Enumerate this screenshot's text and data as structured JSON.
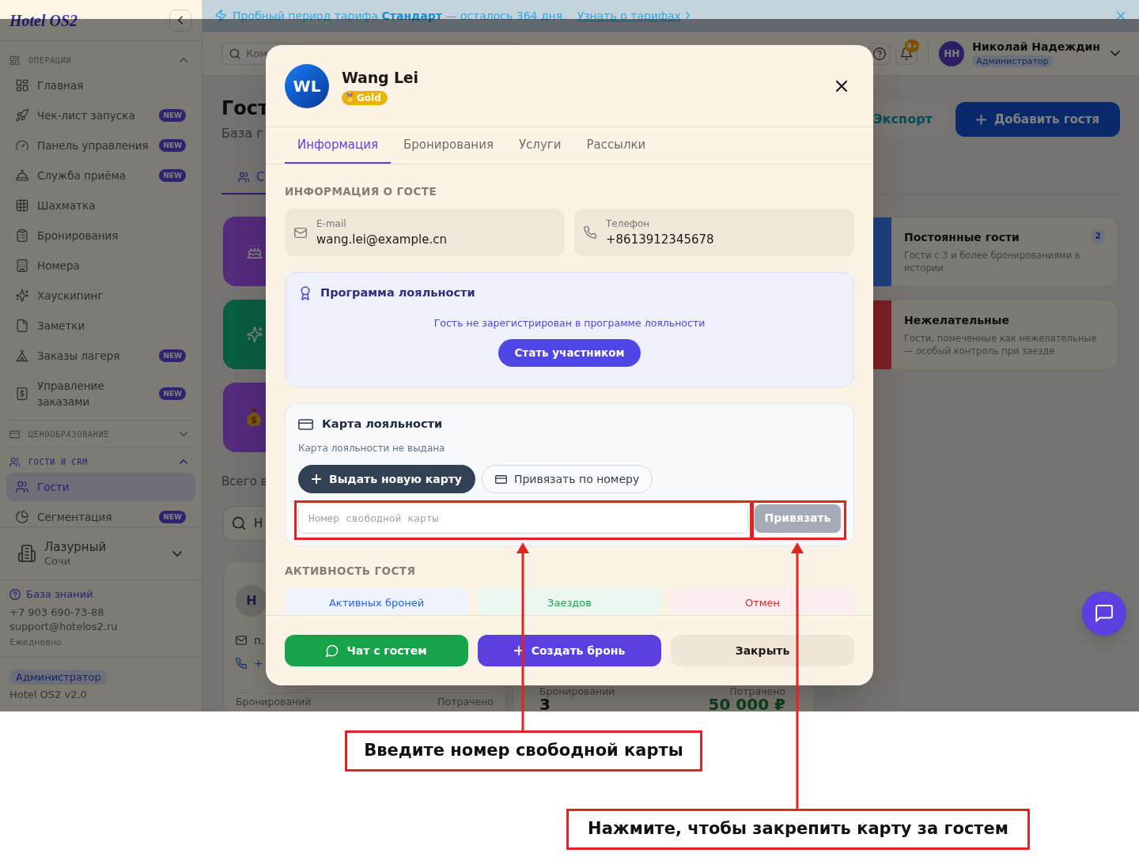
{
  "banner": {
    "text": "Пробный период тарифа **Стандарт** — осталось 364 дня.",
    "link": "Узнать о тарифах"
  },
  "sidebar": {
    "logo": "Hotel OS2",
    "sections": [
      {
        "title": "ОПЕРАЦИИ",
        "expanded": true,
        "items": [
          {
            "label": "Главная",
            "selected": false
          },
          {
            "label": "Чек-лист запуска",
            "badge": "NEW",
            "selected": false
          },
          {
            "label": "Панель управления",
            "badge": "NEW",
            "selected": false
          },
          {
            "label": "Служба приёма",
            "badge": "NEW",
            "selected": false
          },
          {
            "label": "Шахматка",
            "selected": false
          },
          {
            "label": "Бронирования",
            "selected": false
          },
          {
            "label": "Номера",
            "selected": false
          },
          {
            "label": "Хаускипинг",
            "selected": false
          },
          {
            "label": "Заметки",
            "selected": false
          },
          {
            "label": "Заказы лагеря",
            "badge": "NEW",
            "selected": false
          },
          {
            "label": "Управление заказами",
            "badge": "NEW",
            "selected": false
          }
        ]
      },
      {
        "title": "ЦЕНООБРАЗОВАНИЕ",
        "expanded": false
      },
      {
        "title": "ГОСТИ И CRM",
        "expanded": true,
        "items": [
          {
            "label": "Гости",
            "selected": true
          },
          {
            "label": "Сегментация",
            "badge": "NEW",
            "selected": false
          }
        ]
      }
    ],
    "property": {
      "name": "Лазурный",
      "city": "Сочи"
    },
    "support": {
      "link": "База знаний",
      "phone": "+7 903 690-73-88",
      "email": "support@hotelos2.ru",
      "hours": "Ежедневно"
    },
    "role": "Администратор",
    "version": "Hotel OS2 v2.0"
  },
  "header": {
    "search": {
      "placeholder": "Ком"
    },
    "notifications": "9+",
    "user": {
      "initials": "НН",
      "name": "Николай Надеждин",
      "role": "Администратор"
    }
  },
  "page": {
    "title": "Гост",
    "subtitle": "База г",
    "buttons": [
      {
        "kind": "secondary",
        "label": "Экспорт"
      },
      {
        "kind": "primary",
        "label": "Добавить гостя"
      }
    ],
    "tabs": [
      {
        "label": "С",
        "selected": true
      }
    ],
    "segment_tiles": [
      {
        "color": "#542a7b"
      },
      {
        "color": "#085c40"
      },
      {
        "color": "#542a7b"
      }
    ],
    "segment_cards": [
      {
        "title": "Постоянные гости",
        "description": "Гости с 3 и более бронированиями в истории",
        "count": "2",
        "color": "#1e3f7d"
      },
      {
        "title": "Нежелательные",
        "description": "Гости, помеченные как нежелательные — особый контроль при заезде",
        "color": "#7a2022"
      }
    ],
    "total_label": "Всего в",
    "guest_search": {
      "placeholder": "Н"
    },
    "guest_cards": [
      {
        "initial": "Н",
        "email": "n.",
        "phone": "+",
        "stats": [
          {
            "label": "Бронирований"
          },
          {
            "label": "Потрачено"
          }
        ]
      },
      {
        "stats": [
          {
            "label": "Бронирований",
            "value": "3"
          },
          {
            "label": "Потрачено",
            "value": "50 000 ₽"
          }
        ]
      }
    ]
  },
  "modal": {
    "avatar": "WL",
    "name": "Wang Lei",
    "tier": "Gold",
    "tabs": [
      {
        "label": "Информация",
        "selected": true
      },
      {
        "label": "Бронирования",
        "selected": false
      },
      {
        "label": "Услуги",
        "selected": false
      },
      {
        "label": "Рассылки",
        "selected": false
      }
    ],
    "info_title": "ИНФОРМАЦИЯ О ГОСТЕ",
    "contacts": [
      {
        "kind": "email",
        "label": "E-mail",
        "value": "wang.lei@example.cn"
      },
      {
        "kind": "phone",
        "label": "Телефон",
        "value": "+8613912345678"
      }
    ],
    "loyalty_program": {
      "title": "Программа лояльности",
      "message": "Гость не зарегистрирован в программе лояльности",
      "button": "Стать участником"
    },
    "loyalty_card": {
      "title": "Карта лояльности",
      "message": "Карта лояльности не выдана",
      "buttons": [
        {
          "kind": "primary",
          "label": "Выдать новую карту"
        },
        {
          "kind": "outline",
          "label": "Привязать по номеру"
        }
      ],
      "input": {
        "placeholder": "Номер свободной карты"
      },
      "bind_button": {
        "label": "Привязать",
        "disabled": true
      }
    },
    "activity_title": "АКТИВНОСТЬ ГОСТЯ",
    "activity": [
      {
        "label": "Активных броней",
        "color": "#2563eb"
      },
      {
        "label": "Заездов",
        "color": "#16a34a"
      },
      {
        "label": "Отмен",
        "color": "#dc2626"
      }
    ],
    "footer_buttons": [
      {
        "kind": "chat",
        "label": "Чат с гостем"
      },
      {
        "kind": "create",
        "label": "Создать бронь"
      },
      {
        "kind": "close",
        "label": "Закрыть"
      }
    ]
  },
  "annotations": [
    {
      "text": "Введите номер свободной карты"
    },
    {
      "text": "Нажмите, чтобы закрепить карту за гостем"
    }
  ]
}
